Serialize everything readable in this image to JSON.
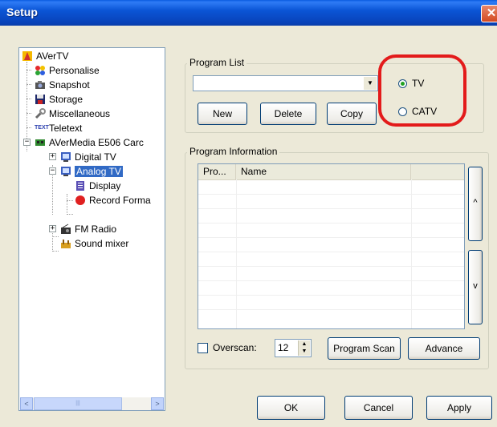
{
  "window": {
    "title": "Setup",
    "close_glyph": "✕"
  },
  "tree": {
    "items": [
      {
        "label": "AVerTV",
        "icon": "avertv-icon"
      },
      {
        "label": "Personalise",
        "icon": "personalise-icon"
      },
      {
        "label": "Snapshot",
        "icon": "camera-icon"
      },
      {
        "label": "Storage",
        "icon": "floppy-disk-icon"
      },
      {
        "label": "Miscellaneous",
        "icon": "wrench-icon"
      },
      {
        "label": "Teletext",
        "icon": "teletext-icon",
        "icon_text": "TEXT"
      },
      {
        "label": "AVerMedia E506 Carc",
        "icon": "tv-card-icon"
      },
      {
        "label": "Digital TV",
        "icon": "digital-tv-icon"
      },
      {
        "label": "Analog TV",
        "icon": "analog-tv-icon",
        "selected": true
      },
      {
        "label": "Display",
        "icon": "display-icon"
      },
      {
        "label": "Record Forma",
        "icon": "record-icon"
      },
      {
        "label": "FM Radio",
        "icon": "radio-icon"
      },
      {
        "label": "Sound mixer",
        "icon": "sound-mixer-icon"
      }
    ],
    "expander_minus": "−",
    "expander_plus": "+",
    "scroll_left": "<",
    "scroll_right": ">",
    "scroll_thumb_grip": "|||"
  },
  "program_list": {
    "legend": "Program List",
    "combo_value": "",
    "combo_arrow": "▼",
    "buttons": {
      "new": "New",
      "delete": "Delete",
      "copy": "Copy"
    },
    "radio_tv": "TV",
    "radio_catv": "CATV",
    "selected": "TV"
  },
  "program_info": {
    "legend": "Program Information",
    "columns": [
      "Pro...",
      "Name"
    ],
    "rows": [],
    "up_label": "^",
    "down_label": "v"
  },
  "overscan": {
    "label": "Overscan:",
    "checked": false,
    "value": "12",
    "spin_up": "▲",
    "spin_down": "▼"
  },
  "buttons": {
    "program_scan": "Program Scan",
    "advance": "Advance",
    "ok": "OK",
    "cancel": "Cancel",
    "apply": "Apply"
  },
  "colors": {
    "annotation": "#e31b1b",
    "selection": "#316ac5",
    "titlebar": "#0b55d6"
  }
}
